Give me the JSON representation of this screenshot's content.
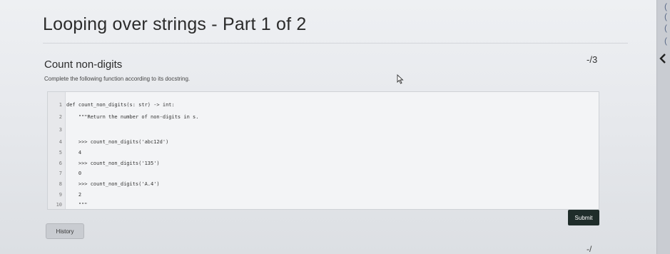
{
  "page": {
    "title": "Looping over strings - Part 1 of 2"
  },
  "question": {
    "title": "Count non-digits",
    "description": "Complete the following function according to its docstring.",
    "points": "-/3"
  },
  "editor": {
    "line_numbers": [
      "1",
      "2",
      "3",
      "4",
      "5",
      "6",
      "7",
      "8",
      "9",
      "10"
    ],
    "lines": [
      "def count_non_digits(s: str) -> int:",
      "    \"\"\"Return the number of non-digits in s.",
      "",
      "    >>> count_non_digits('abc12d')",
      "    4",
      "    >>> count_non_digits('135')",
      "    0",
      "    >>> count_non_digits('A.4')",
      "    2",
      "    \"\"\""
    ]
  },
  "buttons": {
    "submit": "Submit",
    "history": "History"
  },
  "bottom": {
    "points": "-/"
  },
  "right_strip": {
    "marks": [
      "(",
      "(",
      "(",
      "("
    ]
  },
  "colors": {
    "submit_bg": "#1f2d2a",
    "history_bg": "#c9ccd1"
  }
}
